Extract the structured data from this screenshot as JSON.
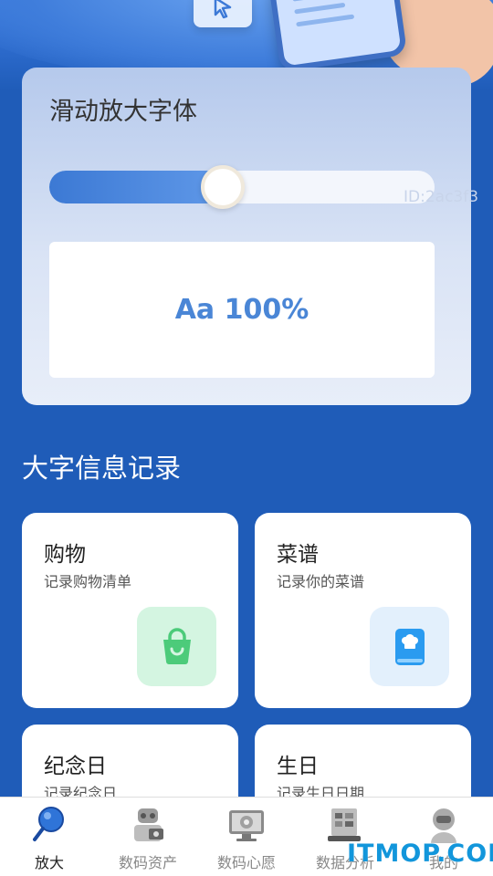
{
  "zoom": {
    "title": "滑动放大字体",
    "slider_fraction": 0.45,
    "preview_text": "Aa 100%",
    "watermark_id": "ID:2ac3f3"
  },
  "section": {
    "title": "大字信息记录"
  },
  "cards": [
    {
      "title": "购物",
      "subtitle": "记录购物清单",
      "icon": "shopping-bag-icon",
      "icon_bg": "#d4f5e1",
      "icon_color": "#4ccb7a"
    },
    {
      "title": "菜谱",
      "subtitle": "记录你的菜谱",
      "icon": "recipe-book-icon",
      "icon_bg": "#e3f0fc",
      "icon_color": "#2a9bf0"
    },
    {
      "title": "纪念日",
      "subtitle": "记录纪念日"
    },
    {
      "title": "生日",
      "subtitle": "记录生日日期"
    }
  ],
  "tabs": [
    {
      "label": "放大",
      "icon": "magnifier-icon",
      "active": true
    },
    {
      "label": "数码资产",
      "icon": "robot-icon"
    },
    {
      "label": "数码心愿",
      "icon": "wish-monitor-icon"
    },
    {
      "label": "数据分析",
      "icon": "data-analysis-icon"
    },
    {
      "label": "我的",
      "icon": "robot-avatar-icon"
    }
  ],
  "site_watermark": "ITMOP.COM",
  "colors": {
    "background": "#1f5cb8",
    "accent": "#4a86d6"
  }
}
